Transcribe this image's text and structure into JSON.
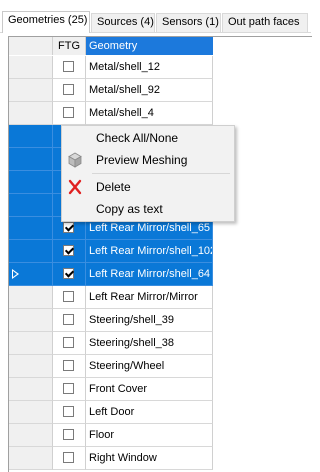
{
  "tabs": [
    {
      "label": "Geometries (25)",
      "active": true
    },
    {
      "label": "Sources (4)",
      "active": false
    },
    {
      "label": "Sensors (1)",
      "active": false
    },
    {
      "label": "Out path faces",
      "active": false
    }
  ],
  "grid": {
    "columns": [
      "",
      "FTG",
      "Geometry"
    ],
    "rows": [
      {
        "name": "Metal/shell_12",
        "checked": false,
        "selected": false,
        "current": false
      },
      {
        "name": "Metal/shell_92",
        "checked": false,
        "selected": false,
        "current": false
      },
      {
        "name": "Metal/shell_4",
        "checked": false,
        "selected": false,
        "current": false
      },
      {
        "name": "",
        "checked": false,
        "selected": true,
        "current": false
      },
      {
        "name": "",
        "checked": false,
        "selected": true,
        "current": false
      },
      {
        "name": "",
        "checked": false,
        "selected": true,
        "current": false
      },
      {
        "name": "",
        "checked": false,
        "selected": true,
        "current": false
      },
      {
        "name": "Left Rear Mirror/shell_65",
        "checked": true,
        "selected": true,
        "current": false
      },
      {
        "name": "Left Rear Mirror/shell_102",
        "checked": true,
        "selected": true,
        "current": false
      },
      {
        "name": "Left Rear Mirror/shell_64",
        "checked": true,
        "selected": true,
        "current": true
      },
      {
        "name": "Left Rear Mirror/Mirror",
        "checked": false,
        "selected": false,
        "current": false
      },
      {
        "name": "Steering/shell_39",
        "checked": false,
        "selected": false,
        "current": false
      },
      {
        "name": "Steering/shell_38",
        "checked": false,
        "selected": false,
        "current": false
      },
      {
        "name": "Steering/Wheel",
        "checked": false,
        "selected": false,
        "current": false
      },
      {
        "name": "Front Cover",
        "checked": false,
        "selected": false,
        "current": false
      },
      {
        "name": "Left Door",
        "checked": false,
        "selected": false,
        "current": false
      },
      {
        "name": "Floor",
        "checked": false,
        "selected": false,
        "current": false
      },
      {
        "name": "Right Window",
        "checked": false,
        "selected": false,
        "current": false
      }
    ]
  },
  "context_menu": {
    "items": [
      {
        "label": "Check All/None",
        "icon": ""
      },
      {
        "label": "Preview Meshing",
        "icon": "cube-icon"
      },
      {
        "label": "Delete",
        "icon": "delete-x-icon"
      },
      {
        "label": "Copy as text",
        "icon": ""
      }
    ]
  },
  "colors": {
    "selection": "#0a78d7",
    "header_highlight": "#1c79dc",
    "delete_icon": "#e02020"
  }
}
